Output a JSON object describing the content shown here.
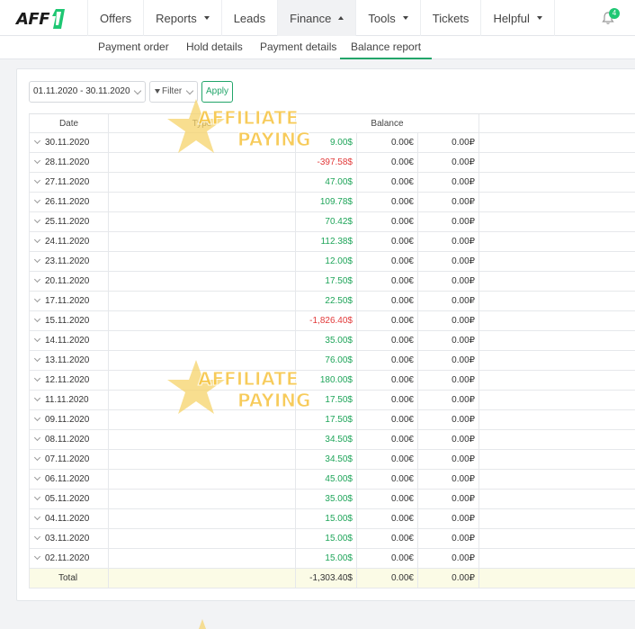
{
  "logo": {
    "text": "AFF"
  },
  "nav": {
    "items": [
      {
        "label": "Offers",
        "has_caret": false,
        "active": false
      },
      {
        "label": "Reports",
        "has_caret": true,
        "active": false
      },
      {
        "label": "Leads",
        "has_caret": false,
        "active": false
      },
      {
        "label": "Finance",
        "has_caret": true,
        "active": true
      },
      {
        "label": "Tools",
        "has_caret": true,
        "active": false
      },
      {
        "label": "Tickets",
        "has_caret": false,
        "active": false
      },
      {
        "label": "Helpful",
        "has_caret": true,
        "active": false
      }
    ],
    "notifications_count": "4"
  },
  "subnav": {
    "items": [
      {
        "label": "Payment order",
        "active": false
      },
      {
        "label": "Hold details",
        "active": false
      },
      {
        "label": "Payment details",
        "active": false
      },
      {
        "label": "Balance report",
        "active": true
      }
    ]
  },
  "filters": {
    "date_range": "01.11.2020 - 30.11.2020",
    "filter_label": "Filter",
    "apply_label": "Apply"
  },
  "table": {
    "headers": {
      "date": "Date",
      "type": "Type",
      "balance": "Balance"
    },
    "rows": [
      {
        "date": "30.11.2020",
        "usd": "9.00$",
        "eur": "0.00€",
        "rub": "0.00₽",
        "sign": "pos"
      },
      {
        "date": "28.11.2020",
        "usd": "-397.58$",
        "eur": "0.00€",
        "rub": "0.00₽",
        "sign": "neg"
      },
      {
        "date": "27.11.2020",
        "usd": "47.00$",
        "eur": "0.00€",
        "rub": "0.00₽",
        "sign": "pos"
      },
      {
        "date": "26.11.2020",
        "usd": "109.78$",
        "eur": "0.00€",
        "rub": "0.00₽",
        "sign": "pos"
      },
      {
        "date": "25.11.2020",
        "usd": "70.42$",
        "eur": "0.00€",
        "rub": "0.00₽",
        "sign": "pos"
      },
      {
        "date": "24.11.2020",
        "usd": "112.38$",
        "eur": "0.00€",
        "rub": "0.00₽",
        "sign": "pos"
      },
      {
        "date": "23.11.2020",
        "usd": "12.00$",
        "eur": "0.00€",
        "rub": "0.00₽",
        "sign": "pos"
      },
      {
        "date": "20.11.2020",
        "usd": "17.50$",
        "eur": "0.00€",
        "rub": "0.00₽",
        "sign": "pos"
      },
      {
        "date": "17.11.2020",
        "usd": "22.50$",
        "eur": "0.00€",
        "rub": "0.00₽",
        "sign": "pos"
      },
      {
        "date": "15.11.2020",
        "usd": "-1,826.40$",
        "eur": "0.00€",
        "rub": "0.00₽",
        "sign": "neg"
      },
      {
        "date": "14.11.2020",
        "usd": "35.00$",
        "eur": "0.00€",
        "rub": "0.00₽",
        "sign": "pos"
      },
      {
        "date": "13.11.2020",
        "usd": "76.00$",
        "eur": "0.00€",
        "rub": "0.00₽",
        "sign": "pos"
      },
      {
        "date": "12.11.2020",
        "usd": "180.00$",
        "eur": "0.00€",
        "rub": "0.00₽",
        "sign": "pos"
      },
      {
        "date": "11.11.2020",
        "usd": "17.50$",
        "eur": "0.00€",
        "rub": "0.00₽",
        "sign": "pos"
      },
      {
        "date": "09.11.2020",
        "usd": "17.50$",
        "eur": "0.00€",
        "rub": "0.00₽",
        "sign": "pos"
      },
      {
        "date": "08.11.2020",
        "usd": "34.50$",
        "eur": "0.00€",
        "rub": "0.00₽",
        "sign": "pos"
      },
      {
        "date": "07.11.2020",
        "usd": "34.50$",
        "eur": "0.00€",
        "rub": "0.00₽",
        "sign": "pos"
      },
      {
        "date": "06.11.2020",
        "usd": "45.00$",
        "eur": "0.00€",
        "rub": "0.00₽",
        "sign": "pos"
      },
      {
        "date": "05.11.2020",
        "usd": "35.00$",
        "eur": "0.00€",
        "rub": "0.00₽",
        "sign": "pos"
      },
      {
        "date": "04.11.2020",
        "usd": "15.00$",
        "eur": "0.00€",
        "rub": "0.00₽",
        "sign": "pos"
      },
      {
        "date": "03.11.2020",
        "usd": "15.00$",
        "eur": "0.00€",
        "rub": "0.00₽",
        "sign": "pos"
      },
      {
        "date": "02.11.2020",
        "usd": "15.00$",
        "eur": "0.00€",
        "rub": "0.00₽",
        "sign": "pos"
      }
    ],
    "total": {
      "label": "Total",
      "usd": "-1,303.40$",
      "eur": "0.00€",
      "rub": "0.00₽"
    }
  },
  "colors": {
    "accent": "#22a56a",
    "positive": "#1fa55a",
    "negative": "#e23a3a"
  },
  "watermark": {
    "line1": "AFFILIATE",
    "line2": "PAYING"
  }
}
